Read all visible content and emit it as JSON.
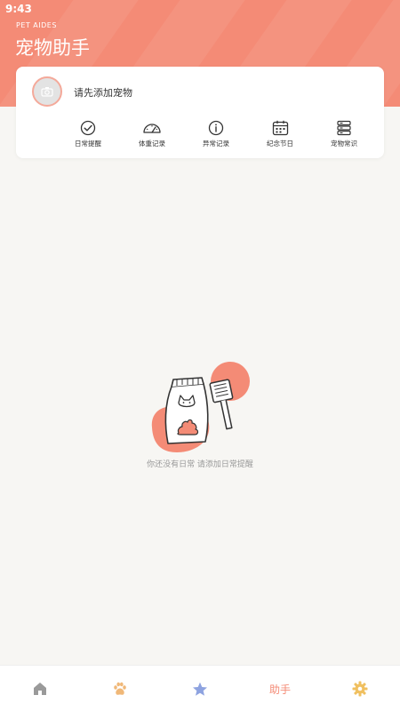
{
  "status_bar": {
    "time": "9:43"
  },
  "header": {
    "subtitle": "PET AIDES",
    "title": "宠物助手"
  },
  "pet_card": {
    "prompt": "请先添加宠物",
    "features": [
      {
        "label": "日常提醒",
        "icon": "check-circle-icon"
      },
      {
        "label": "体重记录",
        "icon": "gauge-icon"
      },
      {
        "label": "异常记录",
        "icon": "info-circle-icon"
      },
      {
        "label": "纪念节日",
        "icon": "calendar-icon"
      },
      {
        "label": "宠物常识",
        "icon": "database-icon"
      }
    ]
  },
  "empty_state": {
    "message": "你还没有日常 请添加日常提醒"
  },
  "bottom_nav": {
    "items": [
      {
        "name": "home",
        "icon": "house-icon",
        "color": "#9a9a9a"
      },
      {
        "name": "pets",
        "icon": "paw-icon",
        "color": "#f0b878"
      },
      {
        "name": "favorites",
        "icon": "star-icon",
        "color": "#8ea3e0"
      },
      {
        "name": "assistant",
        "label": "助手",
        "color": "#f48b76"
      },
      {
        "name": "settings",
        "icon": "gear-icon",
        "color": "#f0c060"
      }
    ]
  },
  "colors": {
    "accent": "#f48b76",
    "background": "#f7f6f3"
  }
}
